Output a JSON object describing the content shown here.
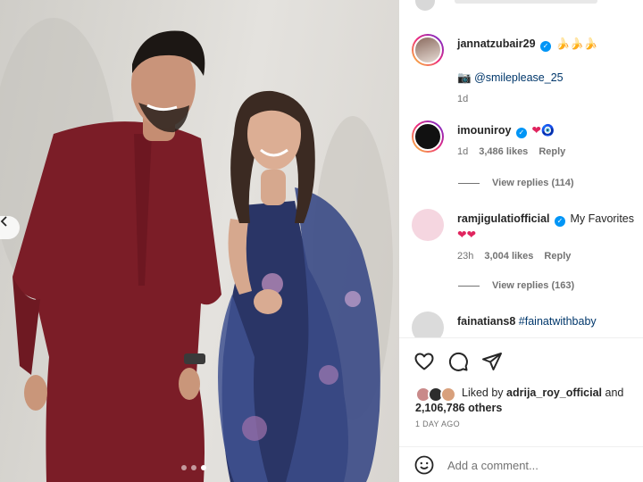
{
  "post": {
    "carousel": {
      "total_slides": 3,
      "active_slide": 3
    }
  },
  "comments": [
    {
      "username": "jannatzubair29",
      "text_emoji": "🍌🍌🍌",
      "camera_emoji": "📷",
      "mention": "@smileplease_25",
      "time": "1d"
    },
    {
      "username": "imouniroy",
      "text_emoji": "❤🧿",
      "time": "1d",
      "likes": "3,486 likes",
      "reply": "Reply",
      "view_replies": "View replies (114)"
    },
    {
      "username": "ramjigulatiofficial",
      "text": "My Favorites",
      "text_emoji": "❤❤",
      "time": "23h",
      "likes": "3,004 likes",
      "reply": "Reply",
      "view_replies": "View replies (163)"
    },
    {
      "username": "fainatians8",
      "mention": "#fainatwithbaby"
    }
  ],
  "likes": {
    "prefix": "Liked by ",
    "user": "adrija_roy_official",
    "connector": " and",
    "others": "2,106,786 others"
  },
  "date": "1 DAY AGO",
  "add_comment": {
    "placeholder": "Add a comment..."
  },
  "colors": {
    "verified": "#0095f6",
    "mention": "#00376b",
    "muted": "#737373",
    "heart": "#e0245e"
  }
}
